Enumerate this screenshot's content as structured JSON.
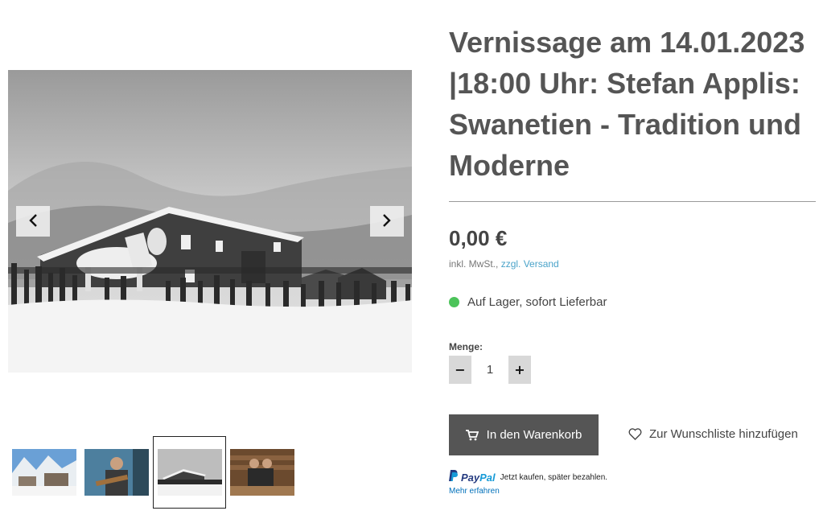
{
  "product": {
    "title": "Vernissage am 14.01.2023 |18:00 Uhr: Stefan Applis: Swanetien - Tradition und Moderne",
    "price": "0,00 €",
    "tax_prefix": "inkl. MwSt., ",
    "shipping_link": "zzgl. Versand",
    "stock_status": "Auf Lager, sofort Lieferbar",
    "stock_color": "#4cc35a"
  },
  "quantity": {
    "label": "Menge:",
    "value": "1",
    "decrement_symbol": "−",
    "increment_symbol": "+"
  },
  "actions": {
    "add_to_cart": "In den Warenkorb",
    "wishlist": "Zur Wunschliste hinzufügen"
  },
  "paypal": {
    "logo_pay": "Pay",
    "logo_pal": "Pal",
    "tagline": "Jetzt kaufen, später bezahlen.",
    "more_link": "Mehr erfahren"
  },
  "gallery": {
    "prev_icon": "chevron-left-icon",
    "next_icon": "chevron-right-icon",
    "active_thumb_index": 2,
    "thumbnails": [
      "snowy-village-thumb",
      "musician-thumb",
      "snowy-house-horse-thumb",
      "seated-people-thumb"
    ]
  },
  "colors": {
    "cart_button": "#555555",
    "link": "#4aa3c9"
  }
}
